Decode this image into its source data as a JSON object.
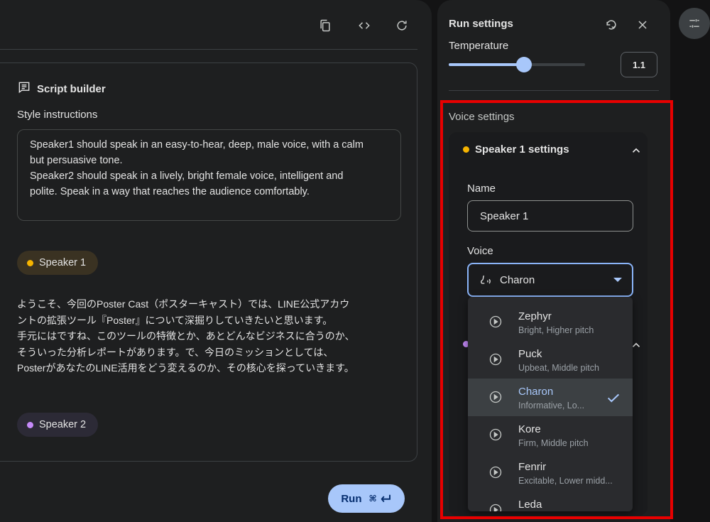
{
  "toolbar": {
    "icons": [
      "copy-icon",
      "code-icon",
      "refresh-icon"
    ]
  },
  "script_builder": {
    "title": "Script builder",
    "style_label": "Style instructions",
    "style_lines": [
      "Speaker1 should speak in an easy-to-hear, deep, male voice, with a calm",
      "but persuasive tone.",
      "Speaker2 should speak in a lively, bright female voice, intelligent and",
      "polite. Speak in a way that reaches the audience comfortably."
    ],
    "speaker1_label": "Speaker 1",
    "speaker2_label": "Speaker 2",
    "speaker1_lines": [
      "ようこそ、今回のPoster Cast（ポスターキャスト）では、LINE公式アカウ",
      "ントの拡張ツール『Poster』について深掘りしていきたいと思います。",
      "手元にはですね、このツールの特徴とか、あとどんなビジネスに合うのか、",
      "そういった分析レポートがあります。で、今日のミッションとしては、",
      "PosterがあなたのLINE活用をどう変えるのか、その核心を探っていきます。"
    ],
    "speaker_colors": {
      "speaker1": "#f6b400",
      "speaker2": "#c58af9"
    }
  },
  "run": {
    "label": "Run",
    "shortcut": "⌘"
  },
  "run_settings": {
    "title": "Run settings",
    "temperature_label": "Temperature",
    "temperature_value": "1.1",
    "temperature_max": 2,
    "voice_settings_label": "Voice settings",
    "speaker1": {
      "heading": "Speaker 1 settings",
      "name_label": "Name",
      "name_value": "Speaker 1",
      "voice_label": "Voice",
      "voice_value": "Charon"
    },
    "voice_options": [
      {
        "name": "Zephyr",
        "desc": "Bright, Higher pitch",
        "selected": false
      },
      {
        "name": "Puck",
        "desc": "Upbeat, Middle pitch",
        "selected": false
      },
      {
        "name": "Charon",
        "desc": "Informative, Lo...",
        "selected": true
      },
      {
        "name": "Kore",
        "desc": "Firm, Middle pitch",
        "selected": false
      },
      {
        "name": "Fenrir",
        "desc": "Excitable, Lower midd...",
        "selected": false
      },
      {
        "name": "Leda",
        "desc": "",
        "selected": false
      }
    ]
  },
  "colors": {
    "accent": "#a8c7fa",
    "highlight": "#e80000"
  }
}
